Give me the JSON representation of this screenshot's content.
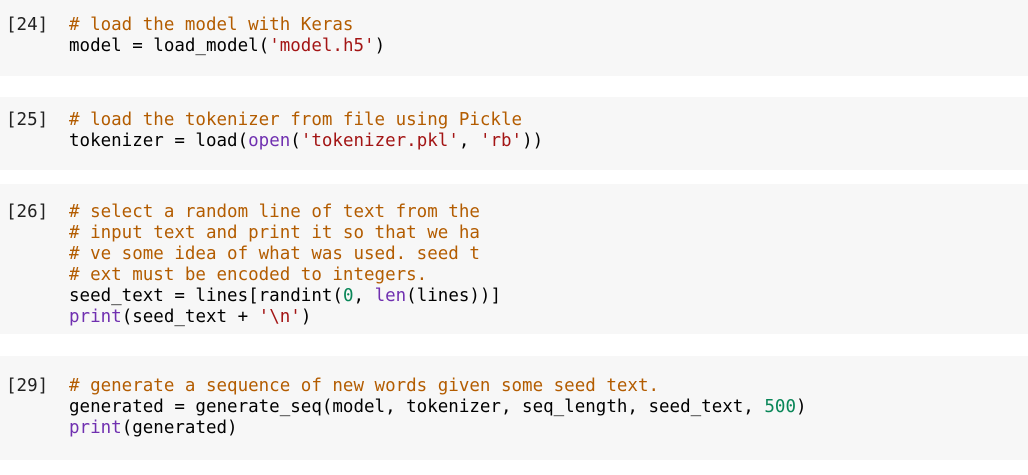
{
  "cells": [
    {
      "prompt": "[24]",
      "lines": [
        [
          {
            "t": "comment",
            "v": "# load the model with Keras"
          }
        ],
        [
          {
            "t": "plain",
            "v": "model = load_model"
          },
          {
            "t": "plain",
            "v": "("
          },
          {
            "t": "string",
            "v": "'model.h5'"
          },
          {
            "t": "plain",
            "v": ")"
          }
        ]
      ]
    },
    {
      "prompt": "[25]",
      "lines": [
        [
          {
            "t": "comment",
            "v": "# load the tokenizer from file using Pickle"
          }
        ],
        [
          {
            "t": "plain",
            "v": "tokenizer = load("
          },
          {
            "t": "func",
            "v": "open"
          },
          {
            "t": "plain",
            "v": "("
          },
          {
            "t": "string",
            "v": "'tokenizer.pkl'"
          },
          {
            "t": "plain",
            "v": ", "
          },
          {
            "t": "string",
            "v": "'rb'"
          },
          {
            "t": "plain",
            "v": "))"
          }
        ]
      ]
    },
    {
      "prompt": "[26]",
      "lines": [
        [
          {
            "t": "comment",
            "v": "# select a random line of text from the"
          }
        ],
        [
          {
            "t": "comment",
            "v": "# input text and print it so that we ha"
          }
        ],
        [
          {
            "t": "comment",
            "v": "# ve some idea of what was used. seed t"
          }
        ],
        [
          {
            "t": "comment",
            "v": "# ext must be encoded to integers."
          }
        ],
        [
          {
            "t": "plain",
            "v": "seed_text = lines[randint("
          },
          {
            "t": "number",
            "v": "0"
          },
          {
            "t": "plain",
            "v": ", "
          },
          {
            "t": "func",
            "v": "len"
          },
          {
            "t": "plain",
            "v": "(lines))]"
          }
        ],
        [
          {
            "t": "func",
            "v": "print"
          },
          {
            "t": "plain",
            "v": "(seed_text + "
          },
          {
            "t": "string",
            "v": "'\\n'"
          },
          {
            "t": "plain",
            "v": ")"
          }
        ]
      ]
    },
    {
      "prompt": "[29]",
      "lines": [
        [
          {
            "t": "comment",
            "v": "# generate a sequence of new words given some seed text."
          }
        ],
        [
          {
            "t": "plain",
            "v": "generated = generate_seq(model, tokenizer, seq_length, seed_text, "
          },
          {
            "t": "number",
            "v": "500"
          },
          {
            "t": "plain",
            "v": ")"
          }
        ],
        [
          {
            "t": "func",
            "v": "print"
          },
          {
            "t": "plain",
            "v": "(generated)"
          }
        ]
      ]
    }
  ]
}
